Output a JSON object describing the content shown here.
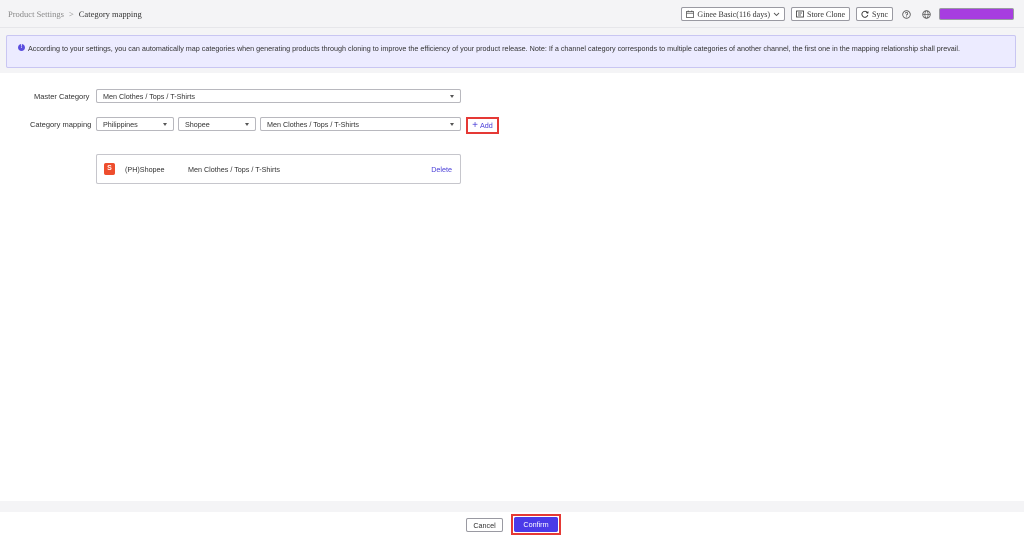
{
  "breadcrumb": {
    "parent": "Product Settings",
    "separator": ">",
    "current": "Category mapping"
  },
  "topbar": {
    "plan_label": "Ginee Basic(116 days)",
    "store_clone_label": "Store Clone",
    "sync_label": "Sync",
    "icons": [
      "calendar-icon",
      "chevron-down-icon",
      "store-icon",
      "sync-icon",
      "help-icon",
      "globe-icon"
    ],
    "user_badge_color": "#a73de0"
  },
  "notice": {
    "icon": "info-icon",
    "text": "According to your settings, you can automatically map categories when generating products through cloning to improve the efficiency of your product release. Note: If a channel category corresponds to multiple categories of another channel, the first one in the mapping relationship shall prevail."
  },
  "form": {
    "master_category_label": "Master Category",
    "master_category_value": "Men Clothes / Tops / T-Shirts",
    "category_mapping_label": "Category mapping",
    "country_value": "Philippines",
    "channel_value": "Shopee",
    "channel_category_value": "Men Clothes / Tops / T-Shirts",
    "add_label": "Add"
  },
  "mappings": [
    {
      "logo_letter": "S",
      "channel": "(PH)Shopee",
      "category": "Men Clothes / Tops / T-Shirts",
      "delete_label": "Delete"
    }
  ],
  "footer": {
    "cancel_label": "Cancel",
    "confirm_label": "Confirm"
  },
  "colors": {
    "accent": "#4b3ae8",
    "highlight": "#e53935",
    "shopee": "#ee4d2d",
    "notice_bg": "#ecebff"
  }
}
